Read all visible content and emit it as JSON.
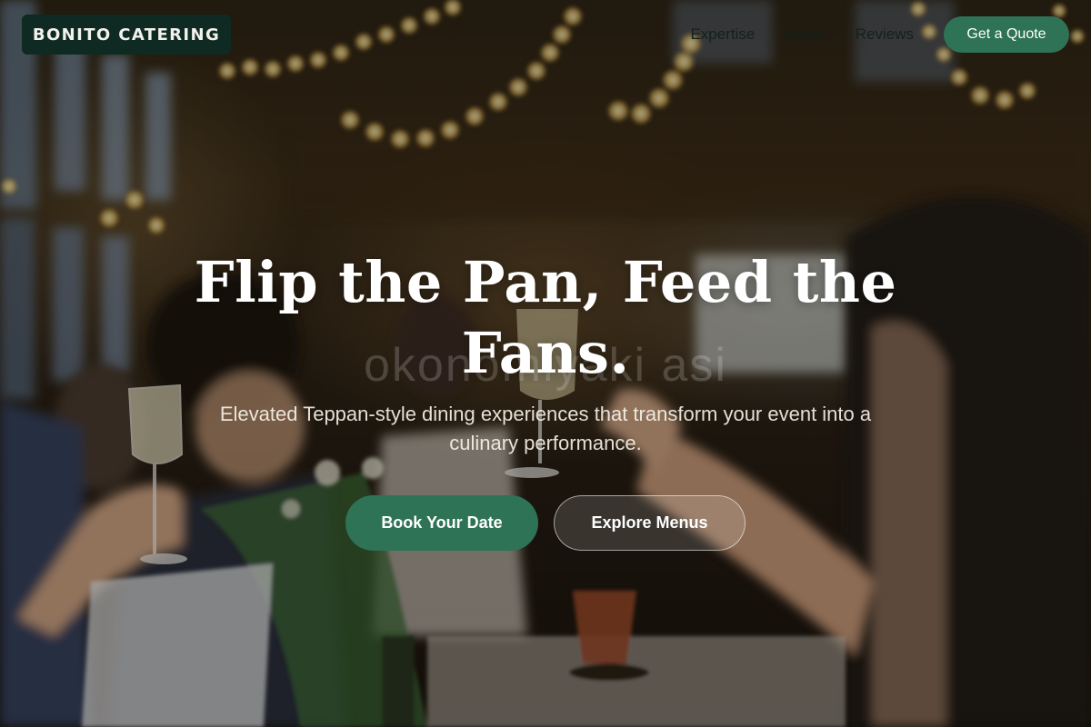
{
  "header": {
    "brand": "BONITO CATERING",
    "nav": [
      "Expertise",
      "About",
      "Reviews"
    ],
    "cta": "Get a Quote"
  },
  "hero": {
    "headline_line1": "Flip the Pan, Feed the",
    "headline_line2": "Fans.",
    "watermark": "okonomiyaki asi",
    "subtitle_line1": "Elevated Teppan-style dining experiences that transform your event into a",
    "subtitle_line2": "culinary performance.",
    "primary_button": "Book Your Date",
    "secondary_button": "Explore Menus"
  },
  "colors": {
    "brand_bg": "#0f2a22",
    "accent_green": "#2e7355"
  }
}
